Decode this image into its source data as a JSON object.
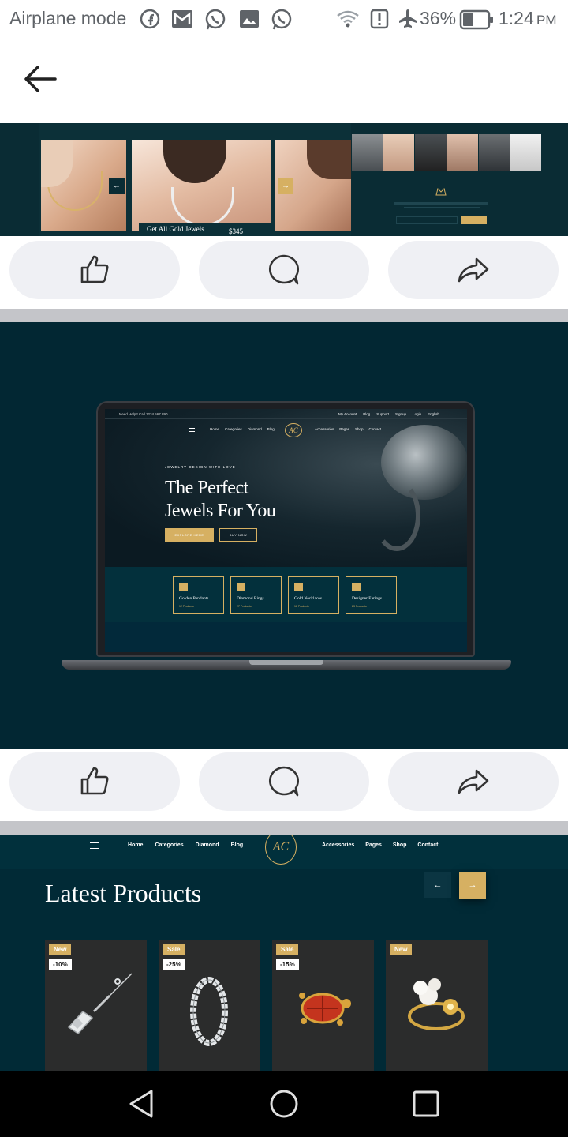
{
  "status_bar": {
    "airplane_label": "Airplane mode",
    "battery": "36%",
    "time": "1:24",
    "ampm": "PM"
  },
  "post1": {
    "card_label": "Get All Gold Jewels",
    "price": "$345",
    "arrow_left": "←",
    "arrow_right": "→"
  },
  "post2": {
    "topbar_help": "Need Help? Call 1234 567 890",
    "topbar_links": [
      "My Account",
      "Blog",
      "Support",
      "Signup",
      "Login",
      "English"
    ],
    "nav_left": [
      "Home",
      "Categories",
      "Diamond",
      "Blog"
    ],
    "nav_right": [
      "Accessories",
      "Pages",
      "Shop",
      "Contact"
    ],
    "logo": "AC",
    "eyebrow": "JEWELRY DESIGN WITH LOVE",
    "hero_line1": "The Perfect",
    "hero_line2": "Jewels For You",
    "btn_explore": "EXPLORE HERE",
    "btn_buy": "BUY NOW",
    "categories": [
      {
        "name": "Golden Pendants",
        "count": "12 Products"
      },
      {
        "name": "Diamond Rings",
        "count": "27 Products"
      },
      {
        "name": "Gold Necklaces",
        "count": "18 Products"
      },
      {
        "name": "Designer Earings",
        "count": "23 Products"
      }
    ]
  },
  "post3": {
    "menu_left": [
      "Home",
      "Categories",
      "Diamond",
      "Blog"
    ],
    "menu_right": [
      "Accessories",
      "Pages",
      "Shop",
      "Contact"
    ],
    "logo": "AC",
    "title": "Latest Products",
    "prev": "←",
    "next": "→",
    "products": [
      {
        "badge": "New",
        "discount": "-10%"
      },
      {
        "badge": "Sale",
        "discount": "-25%"
      },
      {
        "badge": "Sale",
        "discount": "-15%"
      },
      {
        "badge": "New",
        "discount": ""
      }
    ]
  },
  "colors": {
    "teal_dark": "#012a36",
    "gold": "#d6b062",
    "pill_bg": "#eff0f4"
  }
}
